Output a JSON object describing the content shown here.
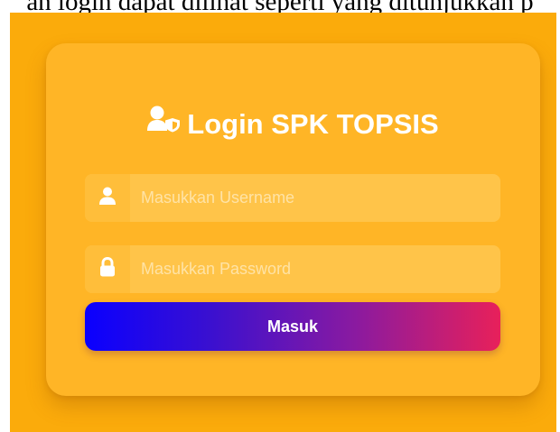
{
  "caption": {
    "text": "an login dapat dilihat seperti yang ditunjukkan p"
  },
  "login_card": {
    "title": "Login SPK TOPSIS",
    "title_icon": "user-shield-icon",
    "username": {
      "placeholder": "Masukkan Username",
      "value": "",
      "icon": "user-icon"
    },
    "password": {
      "placeholder": "Masukkan Password",
      "value": "",
      "icon": "lock-icon"
    },
    "submit_label": "Masuk"
  },
  "colors": {
    "page_background": "#fbab0b",
    "card_background": "#ffb526",
    "button_gradient_start": "#0a00ff",
    "button_gradient_end": "#e8205a",
    "text": "#ffffff"
  }
}
